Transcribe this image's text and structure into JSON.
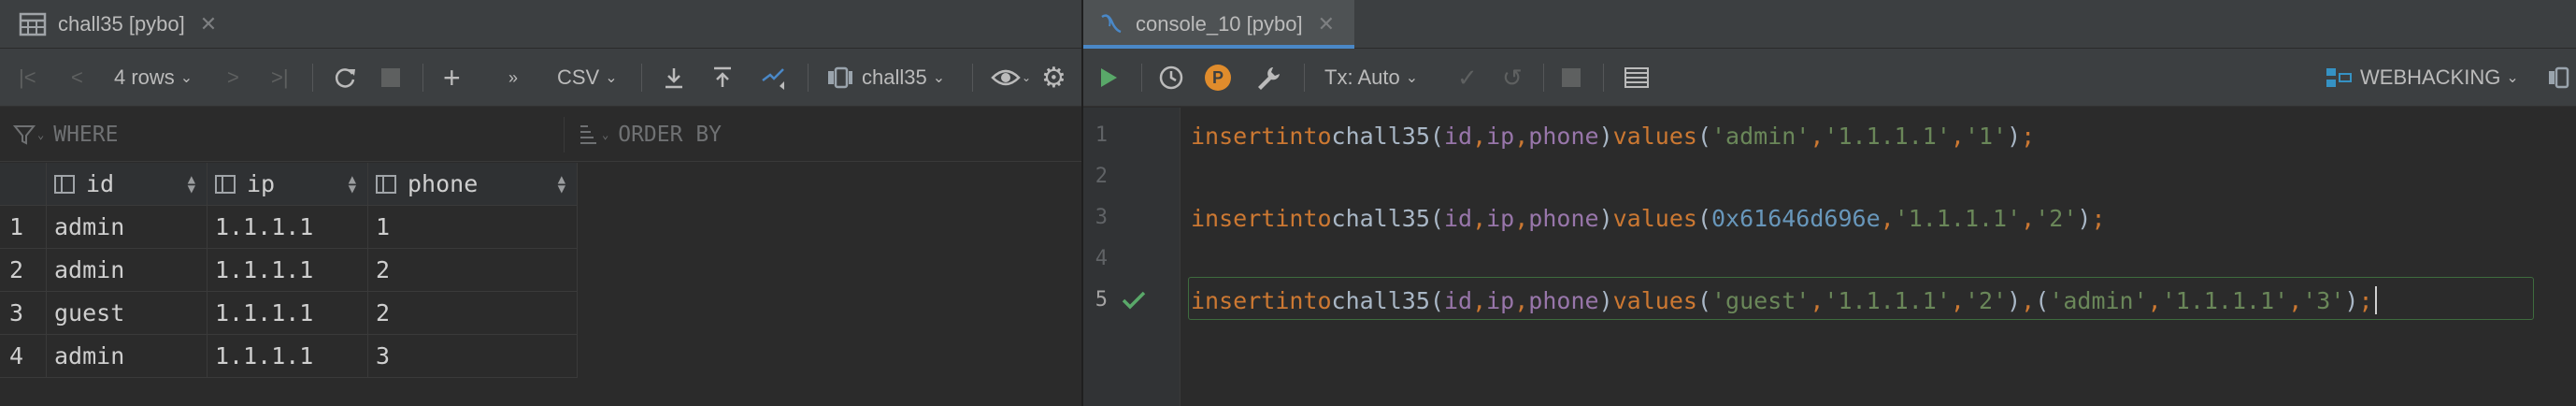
{
  "left_tab": {
    "title": "chall35 [pybo]",
    "icon": "table-icon"
  },
  "right_tab": {
    "title": "console_10 [pybo]",
    "icon": "console-icon"
  },
  "grid_toolbar": {
    "rows_label": "4 rows",
    "format_label": "CSV",
    "datasource_label": "chall35"
  },
  "filter": {
    "where_placeholder": "WHERE",
    "order_placeholder": "ORDER BY"
  },
  "grid": {
    "columns": [
      "id",
      "ip",
      "phone"
    ],
    "rows": [
      {
        "num": "1",
        "id": "admin",
        "ip": "1.1.1.1",
        "phone": "1"
      },
      {
        "num": "2",
        "id": "admin",
        "ip": "1.1.1.1",
        "phone": "2"
      },
      {
        "num": "3",
        "id": "guest",
        "ip": "1.1.1.1",
        "phone": "2"
      },
      {
        "num": "4",
        "id": "admin",
        "ip": "1.1.1.1",
        "phone": "3"
      }
    ]
  },
  "console_toolbar": {
    "tx_label": "Tx: Auto",
    "schema_label": "WEBHACKING",
    "p_badge": "P"
  },
  "editor": {
    "line_numbers": [
      "1",
      "2",
      "3",
      "4",
      "5"
    ],
    "line1": {
      "kw1": "insert",
      "kw2": "into",
      "table": "chall35",
      "c1": "id",
      "c2": "ip",
      "c3": "phone",
      "kw3": "values",
      "v1": "'admin'",
      "v2": "'1.1.1.1'",
      "v3": "'1'"
    },
    "line3": {
      "kw1": "insert",
      "kw2": "into",
      "table": "chall35",
      "c1": "id",
      "c2": "ip",
      "c3": "phone",
      "kw3": "values",
      "v1": "0x61646d696e",
      "v2": "'1.1.1.1'",
      "v3": "'2'"
    },
    "line5": {
      "kw1": "insert",
      "kw2": "into",
      "table": "chall35",
      "c1": "id",
      "c2": "ip",
      "c3": "phone",
      "kw3": "values",
      "v1": "'guest'",
      "v2": "'1.1.1.1'",
      "v3": "'2'",
      "v4": "'admin'",
      "v5": "'1.1.1.1'",
      "v6": "'3'"
    }
  },
  "colors": {
    "accent": "#4a88c7",
    "keyword": "#cc7832",
    "string": "#6a8759",
    "number": "#6897bb",
    "column": "#9876aa",
    "run": "#59a869",
    "badge": "#e08c2c"
  }
}
